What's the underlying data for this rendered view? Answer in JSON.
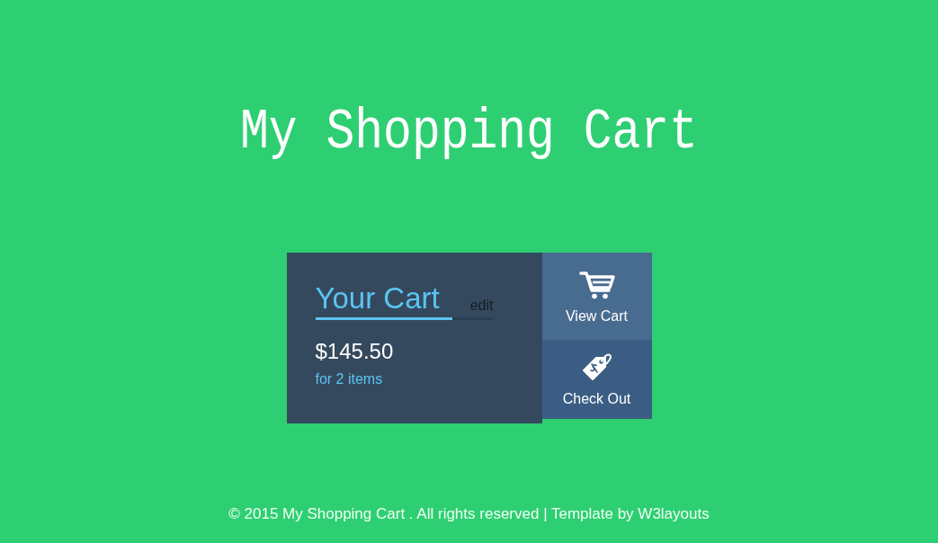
{
  "page": {
    "title": "My Shopping Cart"
  },
  "cart": {
    "title": "Your Cart",
    "edit_link": "edit",
    "total": "$145.50",
    "item_count": "for 2 items"
  },
  "actions": [
    {
      "kind": "view",
      "label": "View Cart"
    },
    {
      "kind": "checkout",
      "label": "Check Out"
    }
  ],
  "footer": {
    "text": "© 2015 My Shopping Cart . All rights reserved | Template by ",
    "link": "W3layouts"
  }
}
